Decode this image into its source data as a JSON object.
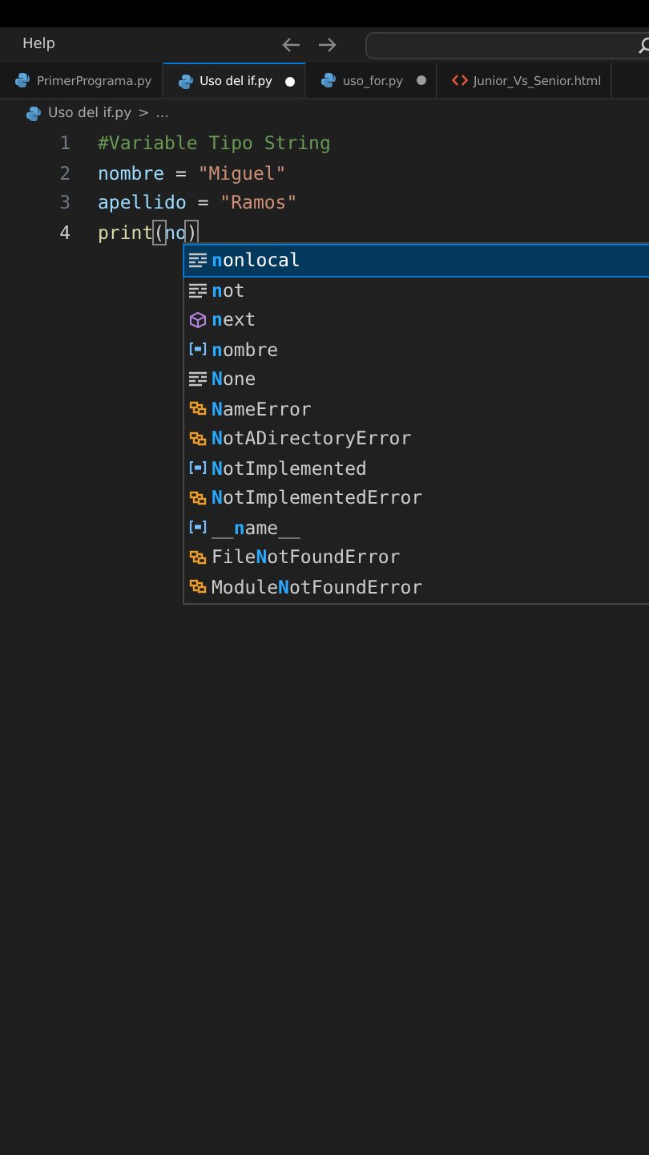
{
  "menu": {
    "items": [
      "Help"
    ]
  },
  "tabs": [
    {
      "label": "PrimerPrograma.py",
      "kind": "python",
      "selected": false,
      "modified": false
    },
    {
      "label": "Uso del if.py",
      "kind": "python",
      "selected": true,
      "modified": true
    },
    {
      "label": "uso_for.py",
      "kind": "python",
      "selected": false,
      "modified": true
    },
    {
      "label": "Junior_Vs_Senior.html",
      "kind": "html",
      "selected": false,
      "modified": false
    }
  ],
  "breadcrumb": {
    "file": "Uso del if.py",
    "separator": ">",
    "rest": "..."
  },
  "editor": {
    "lines": [
      {
        "number": "1",
        "active": false,
        "tokens": [
          {
            "text": "#Variable Tipo String",
            "kind": "comment"
          }
        ]
      },
      {
        "number": "2",
        "active": false,
        "tokens": [
          {
            "text": "nombre",
            "kind": "variable"
          },
          {
            "text": " = ",
            "kind": "operator"
          },
          {
            "text": "\"Miguel\"",
            "kind": "string"
          }
        ]
      },
      {
        "number": "3",
        "active": false,
        "tokens": [
          {
            "text": "apellido",
            "kind": "variable"
          },
          {
            "text": " = ",
            "kind": "operator"
          },
          {
            "text": "\"Ramos\"",
            "kind": "string"
          }
        ]
      },
      {
        "number": "4",
        "active": true,
        "tokens": [
          {
            "text": "print",
            "kind": "function"
          },
          {
            "text": "(",
            "kind": "bracket"
          },
          {
            "text": "no",
            "kind": "variable"
          },
          {
            "text": ")",
            "kind": "bracket"
          }
        ]
      }
    ]
  },
  "suggestions": [
    {
      "label": "**n**onlocal",
      "kind": "keyword",
      "selected": true
    },
    {
      "label": "**n**ot",
      "kind": "keyword",
      "selected": false
    },
    {
      "label": "**n**ext",
      "kind": "function",
      "selected": false
    },
    {
      "label": "**n**ombre",
      "kind": "variable",
      "selected": false
    },
    {
      "label": "**N**one",
      "kind": "keyword",
      "selected": false
    },
    {
      "label": "**N**ameError",
      "kind": "class",
      "selected": false
    },
    {
      "label": "**N**otADirectoryError",
      "kind": "class",
      "selected": false
    },
    {
      "label": "**N**otImplemented",
      "kind": "variable",
      "selected": false
    },
    {
      "label": "**N**otImplementedError",
      "kind": "class",
      "selected": false
    },
    {
      "label": "__**n**ame__",
      "kind": "variable",
      "selected": false
    },
    {
      "label": "File**N**otFoundError",
      "kind": "class",
      "selected": false
    },
    {
      "label": "Module**N**otFoundError",
      "kind": "class",
      "selected": false
    }
  ]
}
